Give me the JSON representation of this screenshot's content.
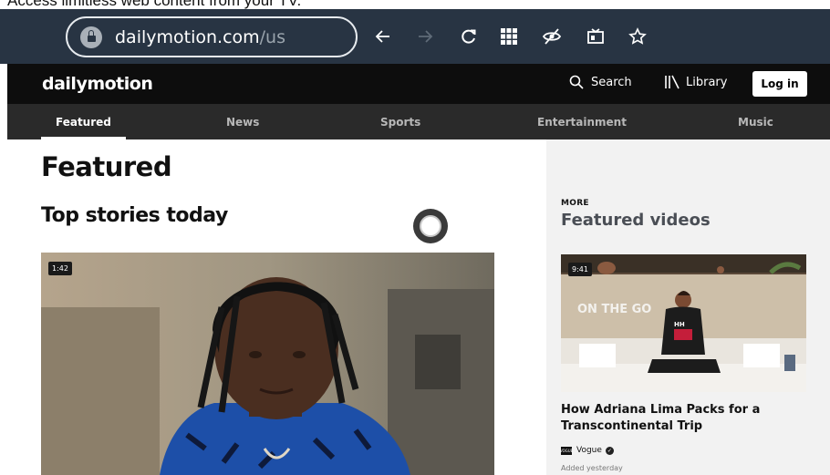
{
  "caption": "Access limitless web content from your TV.",
  "browser": {
    "url_domain": "dailymotion.com",
    "url_path": "/us",
    "icons": [
      "lock-icon",
      "back-icon",
      "forward-icon",
      "reload-icon",
      "apps-grid-icon",
      "hide-icon",
      "cast-icon",
      "star-icon"
    ]
  },
  "header": {
    "logo": "dailymotion",
    "search_label": "Search",
    "library_label": "Library",
    "login_label": "Log in"
  },
  "nav": {
    "tabs": [
      {
        "label": "Featured",
        "active": true
      },
      {
        "label": "News"
      },
      {
        "label": "Sports"
      },
      {
        "label": "Entertainment"
      },
      {
        "label": "Music"
      }
    ]
  },
  "main": {
    "title": "Featured",
    "subtitle": "Top stories today",
    "hero_duration": "1:42"
  },
  "aside": {
    "more_label": "MORE",
    "title": "Featured videos",
    "video": {
      "duration": "9:41",
      "thumb_text": "ON THE GO",
      "title": "How Adriana Lima Packs for a Transcontinental Trip",
      "channel": "Vogue",
      "channel_logo": "VOGUE",
      "added": "Added yesterday"
    }
  },
  "colors": {
    "browser_bar": "#283443",
    "header_bg": "#0d0d0d",
    "nav_bg": "#2a2a2a",
    "aside_bg": "#f2f2f2"
  }
}
